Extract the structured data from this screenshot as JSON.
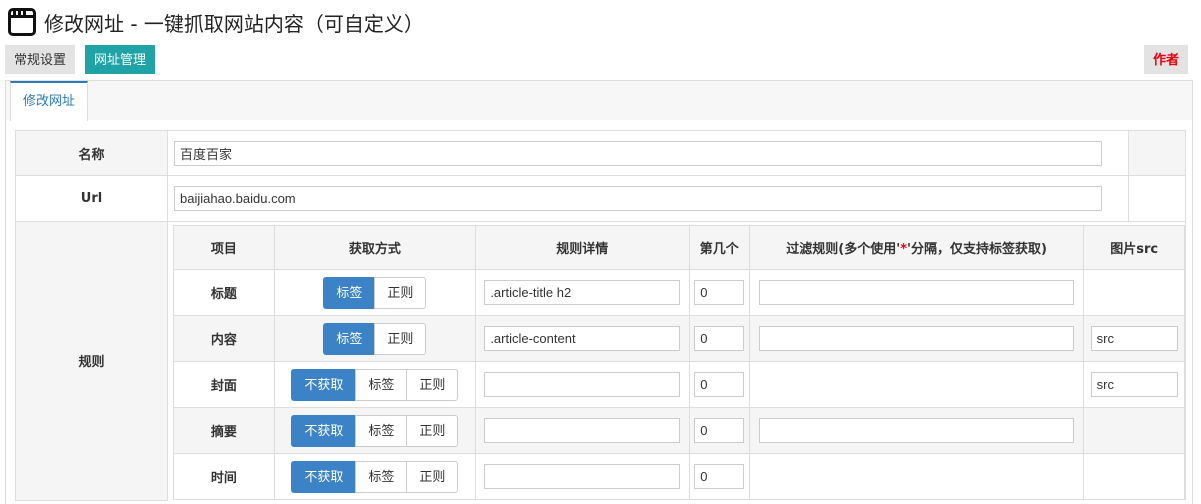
{
  "header": {
    "title": "修改网址 - 一键抓取网站内容（可自定义）"
  },
  "topbar": {
    "general_settings": "常规设置",
    "url_management": "网址管理",
    "author": "作者"
  },
  "tabs": {
    "edit_url": "修改网址"
  },
  "form": {
    "name_label": "名称",
    "name_value": "百度百家",
    "url_label": "Url",
    "url_value": "baijiahao.baidu.com",
    "rules_label": "规则"
  },
  "rules": {
    "headers": {
      "item": "项目",
      "method": "获取方式",
      "detail": "规则详情",
      "nth": "第几个",
      "filter_prefix": "过滤规则(多个使用'",
      "filter_star": "*",
      "filter_suffix": "'分隔，仅支持标签获取)",
      "img": "图片src"
    },
    "options": {
      "none": "不获取",
      "tag": "标签",
      "regex": "正则"
    },
    "rows": [
      {
        "label": "标题",
        "selected": "标签",
        "detail": ".article-title h2",
        "nth": "0",
        "filter": "",
        "img": ""
      },
      {
        "label": "内容",
        "selected": "标签",
        "detail": ".article-content",
        "nth": "0",
        "filter": "",
        "img": "src"
      },
      {
        "label": "封面",
        "selected": "不获取",
        "detail": "",
        "nth": "0",
        "filter": "",
        "img": "src"
      },
      {
        "label": "摘要",
        "selected": "不获取",
        "detail": "",
        "nth": "0",
        "filter": "",
        "img": ""
      },
      {
        "label": "时间",
        "selected": "不获取",
        "detail": "",
        "nth": "0",
        "filter": "",
        "img": ""
      }
    ]
  },
  "colors": {
    "accent_teal": "#1fa3a6",
    "accent_blue": "#3b83c6",
    "author_red": "#e8000b"
  }
}
